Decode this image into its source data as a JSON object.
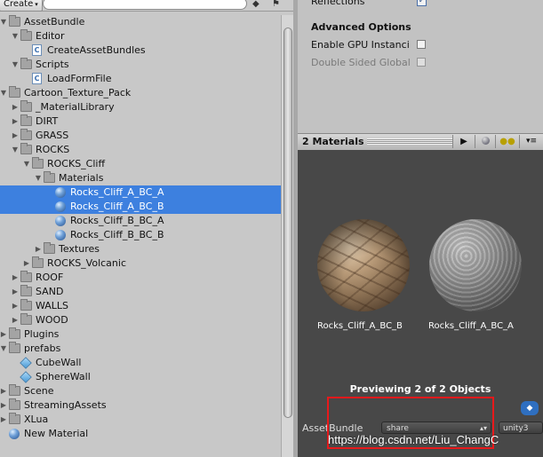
{
  "toolbar": {
    "create_label": "Create",
    "create_arrow": "▾",
    "icon1": "asset-label-icon",
    "icon2": "tag-icon"
  },
  "tree": [
    {
      "label": "AssetBundle",
      "type": "folder",
      "indent": 0,
      "fold": "open",
      "selected": false
    },
    {
      "label": "Editor",
      "type": "folder",
      "indent": 1,
      "fold": "open",
      "selected": false
    },
    {
      "label": "CreateAssetBundles",
      "type": "script",
      "indent": 2,
      "fold": "",
      "selected": false
    },
    {
      "label": "Scripts",
      "type": "folder",
      "indent": 1,
      "fold": "open",
      "selected": false
    },
    {
      "label": "LoadFormFile",
      "type": "script",
      "indent": 2,
      "fold": "",
      "selected": false
    },
    {
      "label": "Cartoon_Texture_Pack",
      "type": "folder",
      "indent": 0,
      "fold": "open",
      "selected": false
    },
    {
      "label": "_MaterialLibrary",
      "type": "folder",
      "indent": 1,
      "fold": "closed",
      "selected": false
    },
    {
      "label": "DIRT",
      "type": "folder",
      "indent": 1,
      "fold": "closed",
      "selected": false
    },
    {
      "label": "GRASS",
      "type": "folder",
      "indent": 1,
      "fold": "closed",
      "selected": false
    },
    {
      "label": "ROCKS",
      "type": "folder",
      "indent": 1,
      "fold": "open",
      "selected": false
    },
    {
      "label": "ROCKS_Cliff",
      "type": "folder",
      "indent": 2,
      "fold": "open",
      "selected": false
    },
    {
      "label": "Materials",
      "type": "folder",
      "indent": 3,
      "fold": "open",
      "selected": false
    },
    {
      "label": "Rocks_Cliff_A_BC_A",
      "type": "material",
      "indent": 4,
      "fold": "",
      "selected": true
    },
    {
      "label": "Rocks_Cliff_A_BC_B",
      "type": "material",
      "indent": 4,
      "fold": "",
      "selected": true
    },
    {
      "label": "Rocks_Cliff_B_BC_A",
      "type": "material",
      "indent": 4,
      "fold": "",
      "selected": false
    },
    {
      "label": "Rocks_Cliff_B_BC_B",
      "type": "material",
      "indent": 4,
      "fold": "",
      "selected": false
    },
    {
      "label": "Textures",
      "type": "folder",
      "indent": 3,
      "fold": "closed",
      "selected": false
    },
    {
      "label": "ROCKS_Volcanic",
      "type": "folder",
      "indent": 2,
      "fold": "closed",
      "selected": false
    },
    {
      "label": "ROOF",
      "type": "folder",
      "indent": 1,
      "fold": "closed",
      "selected": false
    },
    {
      "label": "SAND",
      "type": "folder",
      "indent": 1,
      "fold": "closed",
      "selected": false
    },
    {
      "label": "WALLS",
      "type": "folder",
      "indent": 1,
      "fold": "closed",
      "selected": false
    },
    {
      "label": "WOOD",
      "type": "folder",
      "indent": 1,
      "fold": "closed",
      "selected": false
    },
    {
      "label": "Plugins",
      "type": "folder",
      "indent": 0,
      "fold": "closed",
      "selected": false
    },
    {
      "label": "prefabs",
      "type": "folder",
      "indent": 0,
      "fold": "open",
      "selected": false
    },
    {
      "label": "CubeWall",
      "type": "prefab",
      "indent": 1,
      "fold": "",
      "selected": false
    },
    {
      "label": "SphereWall",
      "type": "prefab",
      "indent": 1,
      "fold": "",
      "selected": false
    },
    {
      "label": "Scene",
      "type": "folder",
      "indent": 0,
      "fold": "closed",
      "selected": false
    },
    {
      "label": "StreamingAssets",
      "type": "folder",
      "indent": 0,
      "fold": "closed",
      "selected": false
    },
    {
      "label": "XLua",
      "type": "folder",
      "indent": 0,
      "fold": "closed",
      "selected": false
    },
    {
      "label": "New Material",
      "type": "material",
      "indent": 0,
      "fold": "",
      "selected": false
    }
  ],
  "inspector": {
    "reflections_label": "Reflections",
    "advanced_options": "Advanced Options",
    "gpu_instancing": "Enable GPU Instanci",
    "double_sided": "Double Sided Global"
  },
  "preview": {
    "title": "2 Materials",
    "play_icon": "play-icon",
    "sphere_icon": "sphere-icon",
    "light_icon": "light-icon",
    "menu_icon": "menu-icon",
    "item_b_label": "Rocks_Cliff_A_BC_B",
    "item_a_label": "Rocks_Cliff_A_BC_A",
    "previewing": "Previewing 2 of 2 Objects"
  },
  "assetbundle": {
    "label": "AssetBundle",
    "value": "share",
    "variant": "unity3"
  },
  "watermark": "https://blog.csdn.net/Liu_ChangC",
  "colors": {
    "selection": "#3d80df",
    "highlight": "#e8191b",
    "preview_bg": "#484848"
  }
}
